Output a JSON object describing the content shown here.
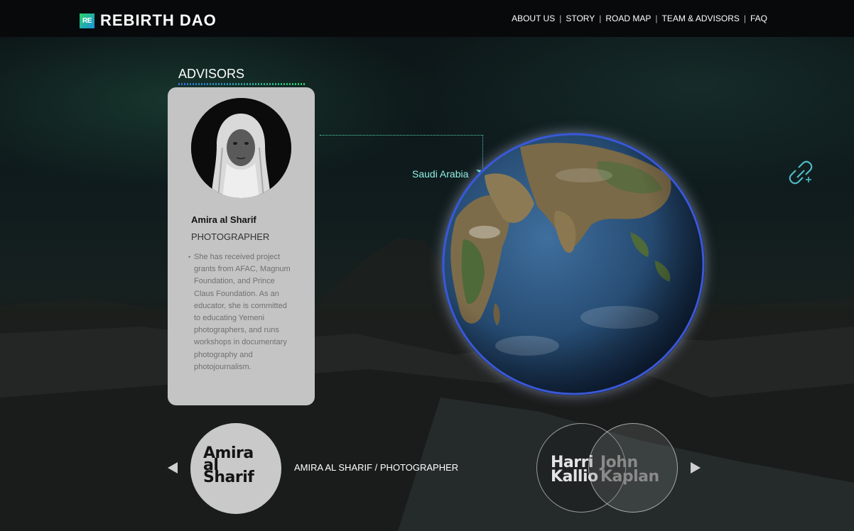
{
  "brand": {
    "logo_mark": "RE",
    "name": "REBIRTH DAO"
  },
  "nav": {
    "items": [
      "ABOUT US",
      "STORY",
      "ROAD MAP",
      "TEAM & ADVISORS",
      "FAQ"
    ],
    "separator": "|"
  },
  "section": {
    "title": "ADVISORS"
  },
  "advisor_card": {
    "name": "Amira al Sharif",
    "role": "PHOTOGRAPHER",
    "bio": "She has received project grants from AFAC, Magnum Foundation, and Prince Claus Foundation. As an educator, she is committed to educating Yemeni photographers, and runs workshops in documentary photography and photojournalism.",
    "bullet": "•"
  },
  "globe": {
    "location_label": "Saudi Arabia",
    "pin_color": "#5fe3d2",
    "ring_color": "#3b58d6"
  },
  "carousel": {
    "active": {
      "name_lines": [
        "Amira",
        "al",
        "Sharif"
      ],
      "caption": "AMIRA AL SHARIF / PHOTOGRAPHER"
    },
    "next": [
      {
        "name_lines": [
          "Harri",
          "Kallio"
        ]
      },
      {
        "name_lines": [
          "John",
          "Kaplan"
        ]
      }
    ]
  },
  "icons": {
    "link": "link-add-icon",
    "prev": "arrow-left-icon",
    "next": "arrow-right-icon"
  },
  "colors": {
    "accent_green": "#2ad26a",
    "accent_blue": "#2f6de0",
    "card_bg": "#c4c4c4"
  }
}
